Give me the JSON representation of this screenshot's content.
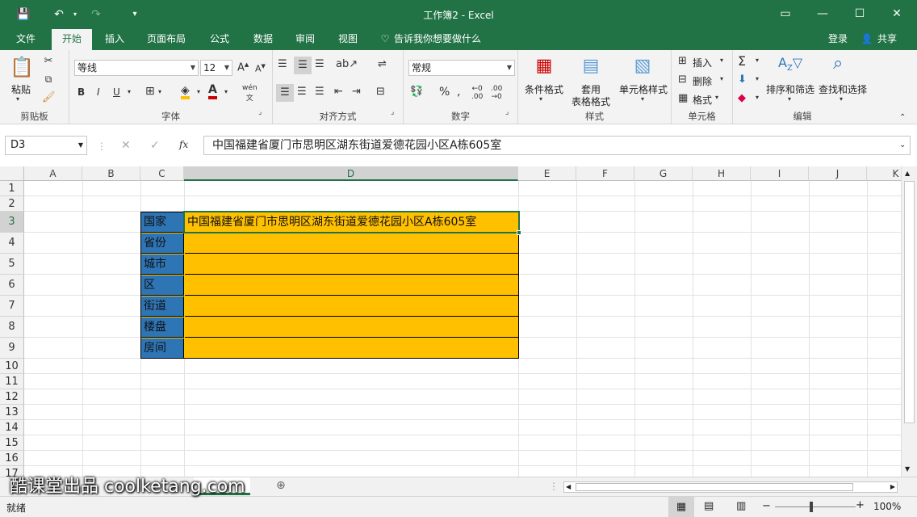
{
  "title": "工作簿2 - Excel",
  "tabs": [
    "文件",
    "开始",
    "插入",
    "页面布局",
    "公式",
    "数据",
    "审阅",
    "视图"
  ],
  "tell_me": "告诉我你想要做什么",
  "login": "登录",
  "share": "共享",
  "ribbon": {
    "clipboard": {
      "paste": "粘贴",
      "label": "剪贴板"
    },
    "font": {
      "name": "等线",
      "size": "12",
      "label": "字体"
    },
    "alignment": {
      "label": "对齐方式"
    },
    "number": {
      "format": "常规",
      "label": "数字"
    },
    "styles": {
      "cond": "条件格式",
      "table1": "套用",
      "table2": "表格格式",
      "cell": "单元格样式",
      "label": "样式"
    },
    "cells": {
      "insert": "插入",
      "delete": "删除",
      "format": "格式",
      "label": "单元格"
    },
    "editing": {
      "sort": "排序和筛选",
      "find": "查找和选择",
      "label": "编辑"
    }
  },
  "formula_bar": {
    "name_box": "D3",
    "fx": "fx",
    "content": "中国福建省厦门市思明区湖东街道爱德花园小区A栋605室"
  },
  "columns": [
    "A",
    "B",
    "C",
    "D",
    "E",
    "F",
    "G",
    "H",
    "I",
    "J",
    "K"
  ],
  "rows": [
    "1",
    "2",
    "3",
    "4",
    "5",
    "6",
    "7",
    "8",
    "9",
    "10",
    "11",
    "12",
    "13",
    "14",
    "15",
    "16",
    "17"
  ],
  "table": {
    "labels": [
      "国家",
      "省份",
      "城市",
      "区",
      "街道",
      "楼盘",
      "房间"
    ],
    "d3": "中国福建省厦门市思明区湖东街道爱德花园小区A栋605室"
  },
  "colors": {
    "brand": "#217346",
    "label_fill": "#2e75b6",
    "value_fill": "#ffc000"
  },
  "status": {
    "ready": "就绪",
    "zoom": "100%"
  },
  "watermark": "酷课堂出品 coolketang.com"
}
